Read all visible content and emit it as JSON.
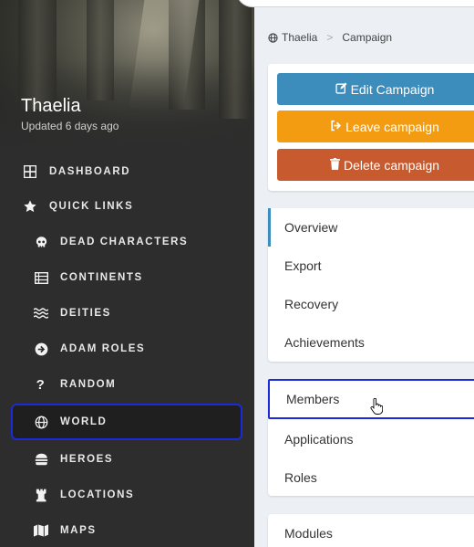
{
  "campaign": {
    "name": "Thaelia",
    "updated": "Updated 6 days ago"
  },
  "sidebar": {
    "items": [
      {
        "label": "DASHBOARD",
        "icon": "dashboard-icon"
      },
      {
        "label": "QUICK LINKS",
        "icon": "star-icon"
      },
      {
        "label": "DEAD CHARACTERS",
        "icon": "skull-icon"
      },
      {
        "label": "CONTINENTS",
        "icon": "list-icon"
      },
      {
        "label": "DEITIES",
        "icon": "water-icon"
      },
      {
        "label": "ADAM ROLES",
        "icon": "arrow-circle-icon"
      },
      {
        "label": "RANDOM",
        "icon": "question-icon"
      },
      {
        "label": "WORLD",
        "icon": "globe-icon"
      },
      {
        "label": "HEROES",
        "icon": "burger-icon"
      },
      {
        "label": "LOCATIONS",
        "icon": "chess-rook-icon"
      },
      {
        "label": "MAPS",
        "icon": "map-icon"
      }
    ]
  },
  "breadcrumb": {
    "root": "Thaelia",
    "separator": ">",
    "current": "Campaign"
  },
  "actions": {
    "edit": "Edit Campaign",
    "leave": "Leave campaign",
    "delete": "Delete campaign"
  },
  "colors": {
    "edit": "#3c8dbc",
    "leave": "#f39c12",
    "delete": "#c75a2e",
    "focus": "#1c2bd8"
  },
  "menu": {
    "group1": [
      "Overview",
      "Export",
      "Recovery",
      "Achievements"
    ],
    "group2": [
      "Members",
      "Applications",
      "Roles"
    ],
    "group3": [
      "Modules"
    ]
  }
}
